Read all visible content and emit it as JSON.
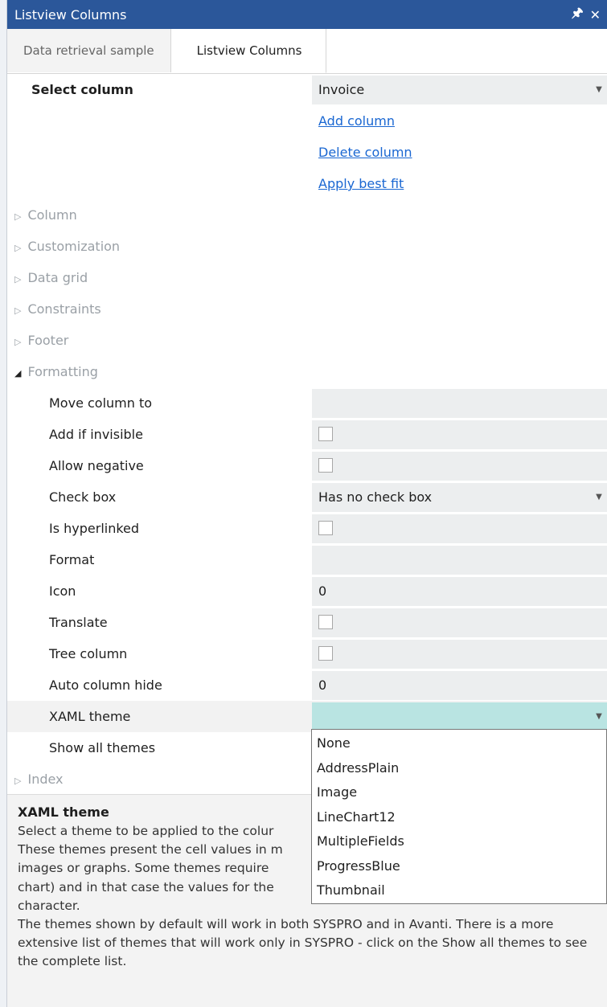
{
  "window": {
    "title": "Listview Columns",
    "pin_icon": "pin-icon",
    "close_icon": "close-icon"
  },
  "tabs": [
    "Data retrieval sample",
    "Listview Columns"
  ],
  "select_column": {
    "label": "Select column",
    "value": "Invoice"
  },
  "actions": [
    "Add column",
    "Delete column",
    "Apply best fit"
  ],
  "sections_collapsed": [
    "Column",
    "Customization",
    "Data grid",
    "Constraints",
    "Footer"
  ],
  "formatting": {
    "label": "Formatting",
    "rows": [
      {
        "label": "Move column to",
        "value": ""
      },
      {
        "label": "Add if invisible",
        "checked": false
      },
      {
        "label": "Allow negative",
        "checked": false
      },
      {
        "label": "Check box",
        "value": "Has no check box"
      },
      {
        "label": "Is hyperlinked",
        "checked": false
      },
      {
        "label": "Format",
        "value": ""
      },
      {
        "label": "Icon",
        "value": "0"
      },
      {
        "label": "Translate",
        "checked": false
      },
      {
        "label": "Tree column",
        "checked": false
      },
      {
        "label": "Auto column hide",
        "value": "0"
      },
      {
        "label": "XAML theme",
        "value": ""
      },
      {
        "label": "Show all themes",
        "value": ""
      }
    ]
  },
  "index_section": "Index",
  "theme_options": [
    "None",
    "AddressPlain",
    "Image",
    "LineChart12",
    "MultipleFields",
    "ProgressBlue",
    "Thumbnail"
  ],
  "help": {
    "title": "XAML theme",
    "line1": "Select a theme to be applied to the colur",
    "line2": "These themes present the cell values in m",
    "line3": "images or graphs. Some themes require",
    "line4": "chart) and in that case the values for the",
    "line5": "character.",
    "line6": "The themes shown by default will work in both SYSPRO and in Avanti. There is a more extensive list of themes that will work only in SYSPRO - click on the Show all themes to see the complete list."
  },
  "colors": {
    "titlebar": "#2b579a",
    "link": "#1a67d2",
    "selected_value": "#b9e4e2"
  }
}
